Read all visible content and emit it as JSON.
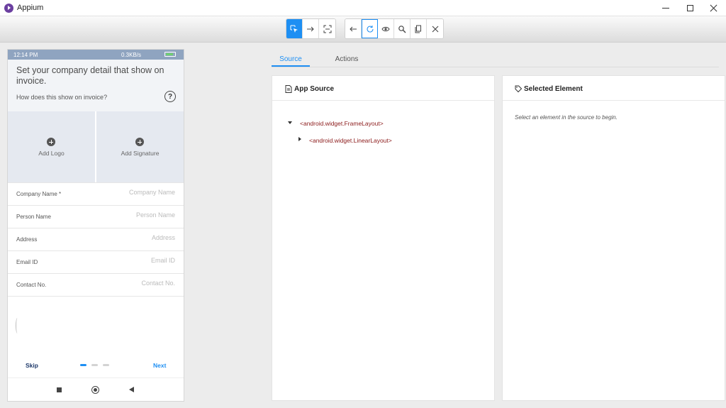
{
  "window": {
    "title": "Appium"
  },
  "toolbar": {
    "left_group": [
      "select-elements-icon",
      "swipe-icon",
      "tap-by-coordinates-icon"
    ],
    "right_group": [
      "back-icon",
      "refresh-icon",
      "eye-icon",
      "search-icon",
      "copy-xml-icon",
      "quit-session-icon"
    ]
  },
  "device": {
    "status_time": "12:14 PM",
    "status_speed": "0.3KB/s",
    "header_title": "Set your company detail that show on invoice.",
    "header_sub": "How does this show on invoice?",
    "help_symbol": "?",
    "add_logo": "Add Logo",
    "add_signature": "Add Signature",
    "fields": [
      {
        "label": "Company Name *",
        "placeholder": "Company Name"
      },
      {
        "label": "Person Name",
        "placeholder": "Person Name"
      },
      {
        "label": "Address",
        "placeholder": "Address"
      },
      {
        "label": "Email ID",
        "placeholder": "Email ID"
      },
      {
        "label": "Contact No.",
        "placeholder": "Contact No."
      }
    ],
    "skip": "Skip",
    "next": "Next",
    "page_indicator": {
      "current": 1,
      "total": 3
    }
  },
  "tabs": {
    "source": "Source",
    "actions": "Actions",
    "active": "Source"
  },
  "source_panel": {
    "title": "App Source",
    "nodes": [
      "<android.widget.FrameLayout>",
      "<android.widget.LinearLayout>"
    ]
  },
  "selected_panel": {
    "title": "Selected Element",
    "hint": "Select an element in the source to begin."
  },
  "colors": {
    "accent": "#1e8ff3",
    "node_text": "#8b1a1a",
    "status_bar": "#8fa4c0"
  }
}
